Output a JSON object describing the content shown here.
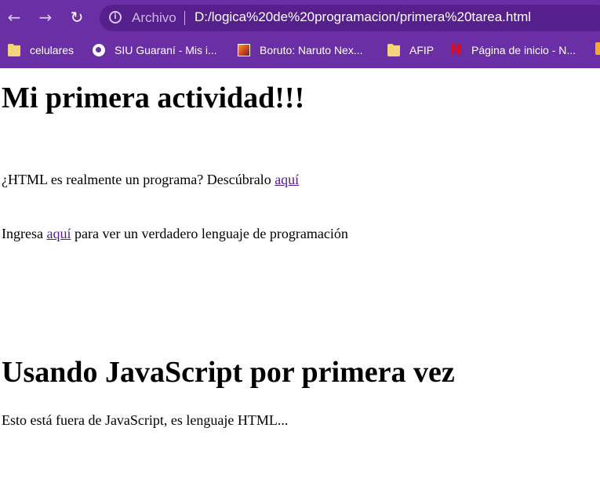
{
  "browser": {
    "scheme_label": "Archivo",
    "url": "D:/logica%20de%20programacion/primera%20tarea.html",
    "bookmarks": [
      {
        "label": "celulares",
        "icon": "folder-icon"
      },
      {
        "label": "SIU Guaraní - Mis i...",
        "icon": "globe-icon"
      },
      {
        "label": "Boruto: Naruto Nex...",
        "icon": "boruto-favicon"
      },
      {
        "label": "AFIP",
        "icon": "folder-icon"
      },
      {
        "label": "Página de inicio - N...",
        "icon": "netflix-icon"
      }
    ],
    "accent_color": "#6a2fa5"
  },
  "page": {
    "heading1": "Mi primera actividad!!!",
    "p1_text": "¿HTML es realmente un programa? Descúbralo ",
    "p1_link": "aquí",
    "p2_before": "Ingresa ",
    "p2_link": "aquí",
    "p2_after": " para ver un verdadero lenguaje de programación",
    "heading2": "Usando JavaScript por primera vez",
    "p3_text": "Esto está fuera de JavaScript, es lenguaje HTML...",
    "link_color": "#551a8b"
  }
}
